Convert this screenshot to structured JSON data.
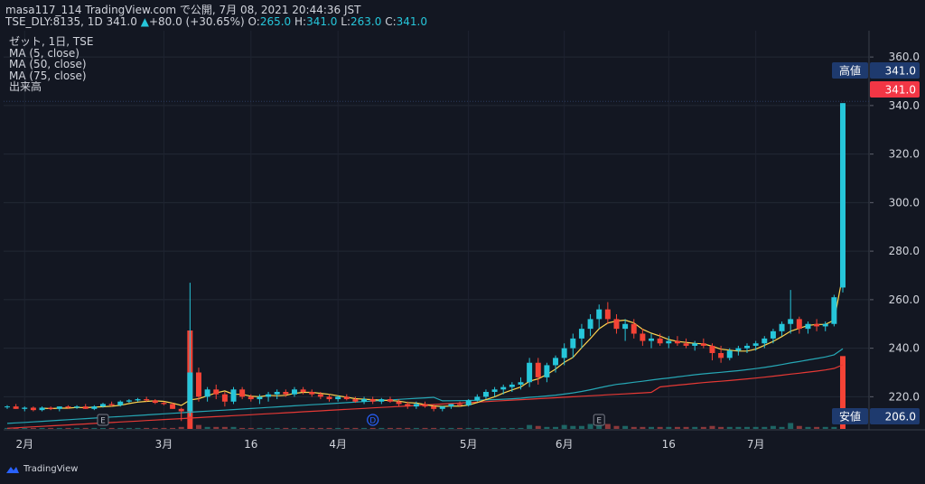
{
  "header": {
    "publisher_line": "masa117_114 TradingView.com で公開, 7月 08, 2021 20:44:36 JST",
    "symbol": "TSE_DLY:8135, 1D",
    "last": "341.0",
    "change_arrow": "▲",
    "change": "+80.0 (+30.65%)",
    "o_label": "O:",
    "o_value": "265.0",
    "h_label": "H:",
    "h_value": "341.0",
    "l_label": "L:",
    "l_value": "263.0",
    "c_label": "C:",
    "c_value": "341.0"
  },
  "legend": {
    "title": "ゼット, 1日, TSE",
    "items": [
      "MA (5, close)",
      "MA (50, close)",
      "MA (75, close)",
      "出来高"
    ]
  },
  "badges": {
    "high_label": "高値",
    "high_value": "341.0",
    "last_value": "341.0",
    "low_label": "安値",
    "low_value": "206.0"
  },
  "event_markers": [
    "E",
    "D",
    "E"
  ],
  "footer": {
    "brand": "TradingView"
  },
  "colors": {
    "up": "#26c6da",
    "down": "#f44336",
    "ma5": "#ffd54f",
    "ma50": "#26a7b5",
    "ma75": "#e53935",
    "bg": "#131722"
  },
  "chart_data": {
    "type": "candlestick",
    "ylim": [
      206,
      366
    ],
    "y_ticks": [
      220.0,
      240.0,
      260.0,
      280.0,
      300.0,
      320.0,
      340.0,
      360.0
    ],
    "x_tick_labels": [
      "2月",
      "3月",
      "16",
      "4月",
      "5月",
      "6月",
      "16",
      "7月"
    ],
    "candles": [
      [
        216,
        216.5,
        215,
        216
      ],
      [
        216,
        217,
        215,
        215
      ],
      [
        215,
        216,
        214,
        215.5
      ],
      [
        215.5,
        216,
        214,
        214.5
      ],
      [
        214.5,
        216,
        214,
        215.5
      ],
      [
        215.5,
        216,
        214.5,
        215
      ],
      [
        215,
        216,
        214,
        216
      ],
      [
        216,
        216.5,
        215,
        215.5
      ],
      [
        215.5,
        216.5,
        215,
        216
      ],
      [
        216,
        217,
        215,
        215
      ],
      [
        215,
        216.5,
        214.5,
        216
      ],
      [
        216,
        217.5,
        215.5,
        217
      ],
      [
        217,
        218,
        216,
        216.5
      ],
      [
        216.5,
        218.5,
        216,
        218
      ],
      [
        218,
        219,
        217.5,
        218.5
      ],
      [
        218.5,
        219.5,
        218,
        219
      ],
      [
        219,
        220,
        218,
        218.5
      ],
      [
        218.5,
        219,
        217,
        217.5
      ],
      [
        217.5,
        218,
        216.5,
        217
      ],
      [
        217,
        217.5,
        215,
        215
      ],
      [
        215,
        215.5,
        210,
        214
      ],
      [
        214,
        267,
        212,
        230
      ],
      [
        230,
        232,
        218,
        220
      ],
      [
        220,
        224,
        218,
        223
      ],
      [
        223,
        225,
        219,
        221
      ],
      [
        221,
        222,
        216,
        218
      ],
      [
        218,
        224,
        217,
        223
      ],
      [
        223,
        224,
        219,
        220
      ],
      [
        220,
        221,
        218,
        219
      ],
      [
        219,
        221,
        217,
        220
      ],
      [
        220,
        222,
        218,
        221
      ],
      [
        221,
        223,
        219,
        222
      ],
      [
        222,
        223,
        220,
        221
      ],
      [
        221,
        224,
        220,
        223
      ],
      [
        223,
        224,
        221,
        222
      ],
      [
        222,
        223,
        220,
        221
      ],
      [
        221,
        222,
        219,
        220
      ],
      [
        220,
        221,
        218,
        219
      ],
      [
        219,
        220.5,
        218,
        220
      ],
      [
        220,
        221,
        218.5,
        219
      ],
      [
        219,
        220,
        217.5,
        218
      ],
      [
        218,
        220,
        217,
        219
      ],
      [
        219,
        220,
        217,
        218
      ],
      [
        218,
        219.5,
        217,
        219
      ],
      [
        219,
        220,
        217.5,
        218
      ],
      [
        218,
        219,
        216,
        217
      ],
      [
        217,
        218,
        215,
        216
      ],
      [
        216,
        218,
        215,
        217
      ],
      [
        217,
        218,
        215.5,
        216
      ],
      [
        216,
        217,
        214,
        215
      ],
      [
        215,
        216,
        214,
        216
      ],
      [
        216,
        217,
        215,
        217
      ],
      [
        217,
        218,
        216,
        216.5
      ],
      [
        216.5,
        219,
        216,
        218.5
      ],
      [
        218.5,
        221,
        218,
        220
      ],
      [
        220,
        223,
        219,
        222
      ],
      [
        222,
        224,
        220,
        223
      ],
      [
        223,
        225,
        221,
        224
      ],
      [
        224,
        226,
        222,
        225
      ],
      [
        225,
        228,
        223,
        226
      ],
      [
        226,
        236,
        224,
        234
      ],
      [
        234,
        236,
        225,
        228
      ],
      [
        228,
        234,
        226,
        233
      ],
      [
        233,
        237,
        230,
        236
      ],
      [
        236,
        242,
        233,
        240
      ],
      [
        240,
        246,
        236,
        244
      ],
      [
        244,
        250,
        240,
        248
      ],
      [
        248,
        254,
        245,
        252
      ],
      [
        252,
        258,
        248,
        256
      ],
      [
        256,
        259,
        250,
        252
      ],
      [
        252,
        254,
        246,
        248
      ],
      [
        248,
        252,
        243,
        250
      ],
      [
        250,
        252,
        244,
        246
      ],
      [
        246,
        248,
        241,
        243
      ],
      [
        243,
        246,
        240,
        244
      ],
      [
        244,
        246,
        241,
        242
      ],
      [
        242,
        245,
        240,
        243
      ],
      [
        243,
        245,
        241,
        242
      ],
      [
        242,
        244,
        240,
        241
      ],
      [
        241,
        243,
        239,
        242
      ],
      [
        242,
        244,
        240,
        241
      ],
      [
        241,
        242,
        235,
        238
      ],
      [
        238,
        241,
        234,
        236
      ],
      [
        236,
        240,
        235,
        239
      ],
      [
        239,
        241,
        237,
        240
      ],
      [
        240,
        242,
        238,
        241
      ],
      [
        241,
        243,
        239,
        242
      ],
      [
        242,
        245,
        240,
        244
      ],
      [
        244,
        248,
        242,
        247
      ],
      [
        247,
        251,
        245,
        250
      ],
      [
        250,
        264,
        246,
        252
      ],
      [
        252,
        253,
        246,
        248
      ],
      [
        248,
        251,
        246,
        250
      ],
      [
        250,
        252,
        247,
        249
      ],
      [
        249,
        251,
        247,
        250
      ],
      [
        250,
        262,
        249,
        261
      ],
      [
        265,
        341,
        263,
        341
      ]
    ],
    "volume_max_value": 100,
    "volumes": [
      1,
      1,
      1,
      1,
      1,
      1,
      1,
      1,
      1,
      1,
      1,
      1,
      1,
      1,
      1,
      1,
      1,
      1,
      1,
      1,
      2,
      100,
      4,
      2,
      2,
      2,
      2,
      1,
      1,
      1,
      1,
      1,
      1,
      1,
      1,
      1,
      1,
      1,
      1,
      1,
      1,
      1,
      1,
      1,
      1,
      1,
      1,
      1,
      1,
      1,
      1,
      1,
      1,
      1,
      1,
      1,
      1,
      1,
      1,
      1,
      4,
      3,
      2,
      2,
      4,
      3,
      3,
      5,
      6,
      5,
      3,
      3,
      2,
      2,
      2,
      2,
      2,
      2,
      2,
      2,
      2,
      3,
      2,
      2,
      2,
      2,
      2,
      2,
      3,
      2,
      6,
      3,
      2,
      2,
      2,
      2,
      74
    ]
  }
}
